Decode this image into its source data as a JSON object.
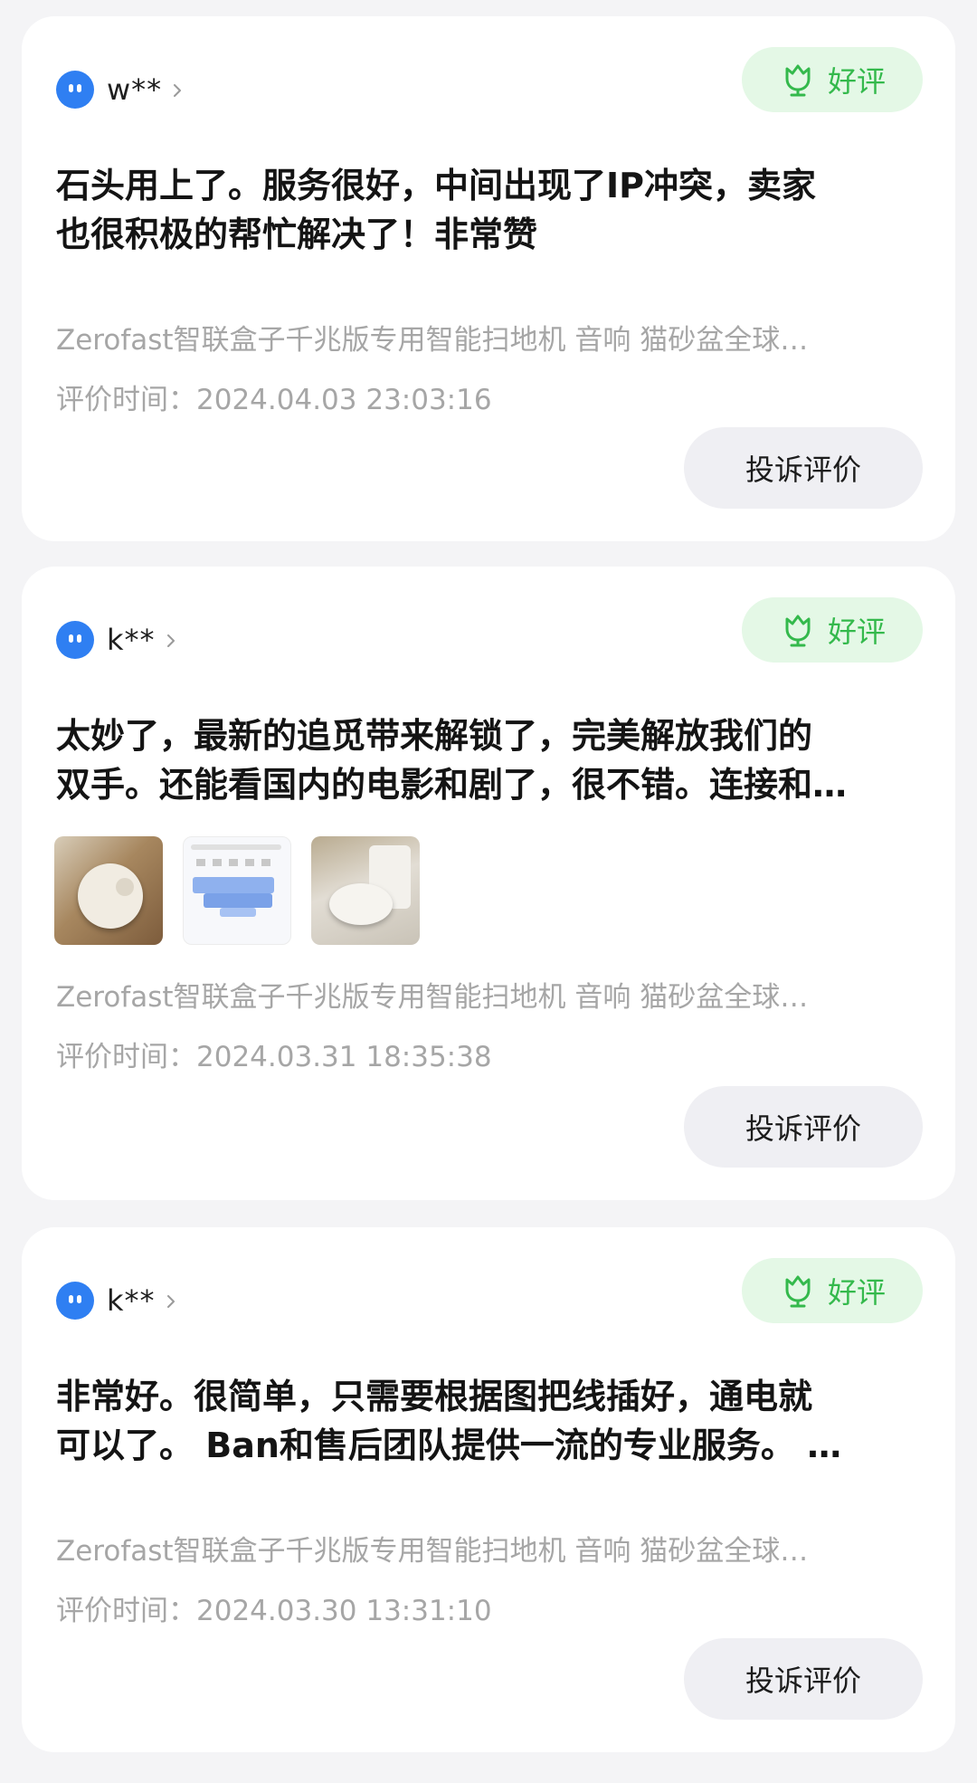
{
  "colors": {
    "page_background": "#f4f4f6",
    "card_background": "#ffffff",
    "avatar": "#2f7ff2",
    "badge_background": "#e4f8e6",
    "badge_accent": "#34b94c",
    "muted_text": "#a6a6a6",
    "button_background": "#efeff3"
  },
  "reviews": [
    {
      "username": "w**",
      "badge": "好评",
      "badge_icon": "tulip-icon",
      "text_lines": [
        "石头用上了。服务很好，中间出现了IP冲突，卖家",
        "也很积极的帮忙解决了！非常赞"
      ],
      "photos": [],
      "product": "Zerofast智联盒子千兆版专用智能扫地机 音响 猫砂盆全球…",
      "time": "评价时间：2024.04.03 23:03:16",
      "complain_label": "投诉评价"
    },
    {
      "username": "k**",
      "badge": "好评",
      "badge_icon": "tulip-icon",
      "text_lines": [
        "太妙了，最新的追觅带来解锁了，完美解放我们的",
        "双手。还能看国内的电影和剧了，很不错。连接和…"
      ],
      "photos": [
        "robot-vacuum-photo",
        "app-map-screenshot",
        "robot-dock-photo"
      ],
      "product": "Zerofast智联盒子千兆版专用智能扫地机 音响 猫砂盆全球…",
      "time": "评价时间：2024.03.31 18:35:38",
      "complain_label": "投诉评价"
    },
    {
      "username": "k**",
      "badge": "好评",
      "badge_icon": "tulip-icon",
      "text_lines": [
        "非常好。很简单，只需要根据图把线插好，通电就",
        "可以了。 Ban和售后团队提供一流的专业服务。 …"
      ],
      "photos": [],
      "product": "Zerofast智联盒子千兆版专用智能扫地机 音响 猫砂盆全球…",
      "time": "评价时间：2024.03.30 13:31:10",
      "complain_label": "投诉评价"
    }
  ]
}
